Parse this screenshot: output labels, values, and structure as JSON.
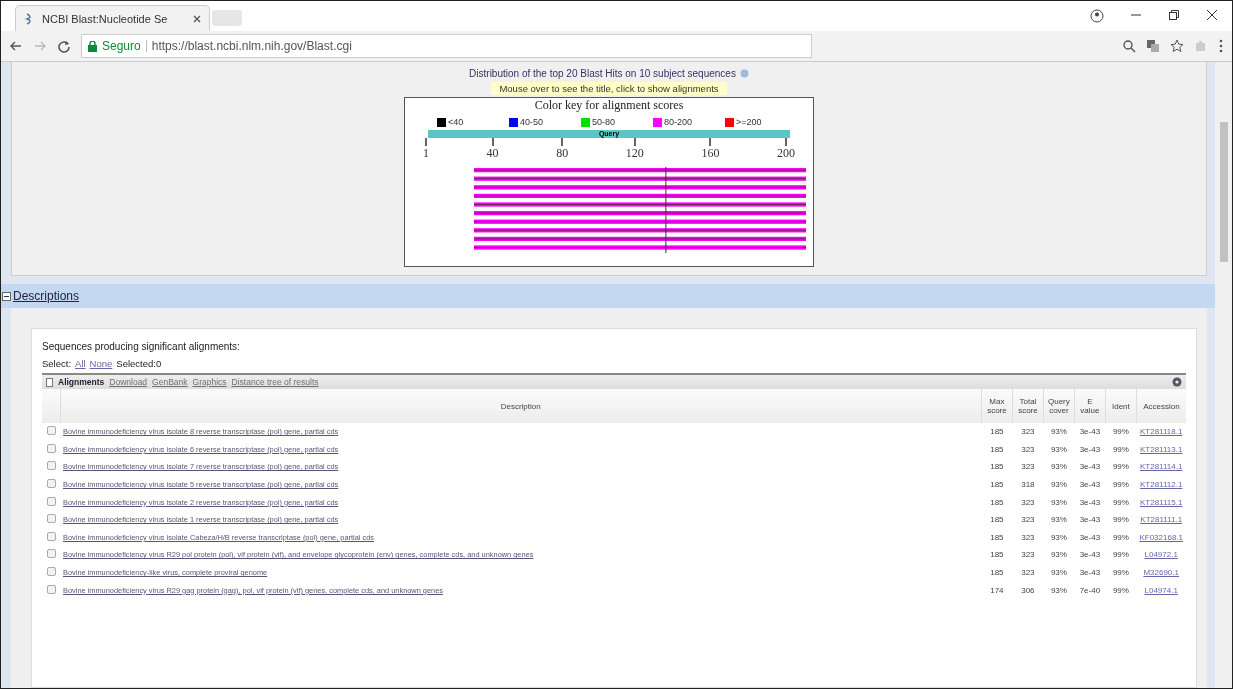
{
  "browser": {
    "tab_title": "NCBI Blast:Nucleotide Se",
    "secure_label": "Seguro",
    "url": "https://blast.ncbi.nlm.nih.gov/Blast.cgi"
  },
  "graphic": {
    "caption": "Distribution of the top 20 Blast Hits on 10 subject sequences",
    "hint": "Mouse over to see the title, click to show alignments",
    "key_title": "Color key for alignment scores",
    "legend": [
      {
        "label": "<40",
        "color": "#000000"
      },
      {
        "label": "40-50",
        "color": "#0000ff"
      },
      {
        "label": "50-80",
        "color": "#00e000"
      },
      {
        "label": "80-200",
        "color": "#ff00ff"
      },
      {
        "label": ">=200",
        "color": "#ff0000"
      }
    ],
    "query_label": "Query",
    "ticks": [
      "1",
      "40",
      "80",
      "120",
      "160",
      "200"
    ]
  },
  "descriptions": {
    "title": "Descriptions",
    "expanded": true,
    "intro": "Sequences producing significant alignments:",
    "select_label": "Select:",
    "select_all": "All",
    "select_none": "None",
    "selected_count": "Selected:0",
    "toolbar": [
      "Alignments",
      "Download",
      "GenBank",
      "Graphics",
      "Distance tree of results"
    ],
    "columns": [
      "Description",
      "Max score",
      "Total score",
      "Query cover",
      "E value",
      "Ident",
      "Accession"
    ],
    "rows": [
      {
        "description": "Bovine immunodeficiency virus isolate 8 reverse transcriptase (pol) gene, partial cds",
        "max_score": "185",
        "total_score": "323",
        "query_cover": "93%",
        "e_value": "3e-43",
        "ident": "99%",
        "accession": "KT281118.1",
        "checked": false
      },
      {
        "description": "Bovine immunodeficiency virus isolate 6 reverse transcriptase (pol) gene, partial cds",
        "max_score": "185",
        "total_score": "323",
        "query_cover": "93%",
        "e_value": "3e-43",
        "ident": "99%",
        "accession": "KT281113.1",
        "checked": false
      },
      {
        "description": "Bovine immunodeficiency virus isolate 7 reverse transcriptase (pol) gene, partial cds",
        "max_score": "185",
        "total_score": "323",
        "query_cover": "93%",
        "e_value": "3e-43",
        "ident": "99%",
        "accession": "KT281114.1",
        "checked": false
      },
      {
        "description": "Bovine immunodeficiency virus isolate 5 reverse transcriptase (pol) gene, partial cds",
        "max_score": "185",
        "total_score": "318",
        "query_cover": "93%",
        "e_value": "3e-43",
        "ident": "99%",
        "accession": "KT281112.1",
        "checked": false
      },
      {
        "description": "Bovine immunodeficiency virus isolate 2 reverse transcriptase (pol) gene, partial cds",
        "max_score": "185",
        "total_score": "323",
        "query_cover": "93%",
        "e_value": "3e-43",
        "ident": "99%",
        "accession": "KT281115.1",
        "checked": false
      },
      {
        "description": "Bovine immunodeficiency virus isolate 1 reverse transcriptase (pol) gene, partial cds",
        "max_score": "185",
        "total_score": "323",
        "query_cover": "93%",
        "e_value": "3e-43",
        "ident": "99%",
        "accession": "KT281111.1",
        "checked": false
      },
      {
        "description": "Bovine immunodeficiency virus isolate Cabeza/H/B reverse transcriptase (pol) gene, partial cds",
        "max_score": "185",
        "total_score": "323",
        "query_cover": "93%",
        "e_value": "3e-43",
        "ident": "99%",
        "accession": "KF032168.1",
        "checked": false
      },
      {
        "description": "Bovine immunodeficiency virus R29 pol protein (pol), vif protein (vif), and envelope glycoprotein (env) genes, complete cds, and unknown genes",
        "max_score": "185",
        "total_score": "323",
        "query_cover": "93%",
        "e_value": "3e-43",
        "ident": "99%",
        "accession": "L04972.1",
        "checked": false
      },
      {
        "description": "Bovine immunodeficiency-like virus, complete proviral genome",
        "max_score": "185",
        "total_score": "323",
        "query_cover": "93%",
        "e_value": "3e-43",
        "ident": "99%",
        "accession": "M32690.1",
        "checked": false
      },
      {
        "description": "Bovine immunodeficiency virus R29 gag protein (gag), pol, vif protein (vif) genes, complete cds, and unknown genes",
        "max_score": "174",
        "total_score": "306",
        "query_cover": "93%",
        "e_value": "7e-40",
        "ident": "99%",
        "accession": "L04974.1",
        "checked": false
      }
    ]
  }
}
